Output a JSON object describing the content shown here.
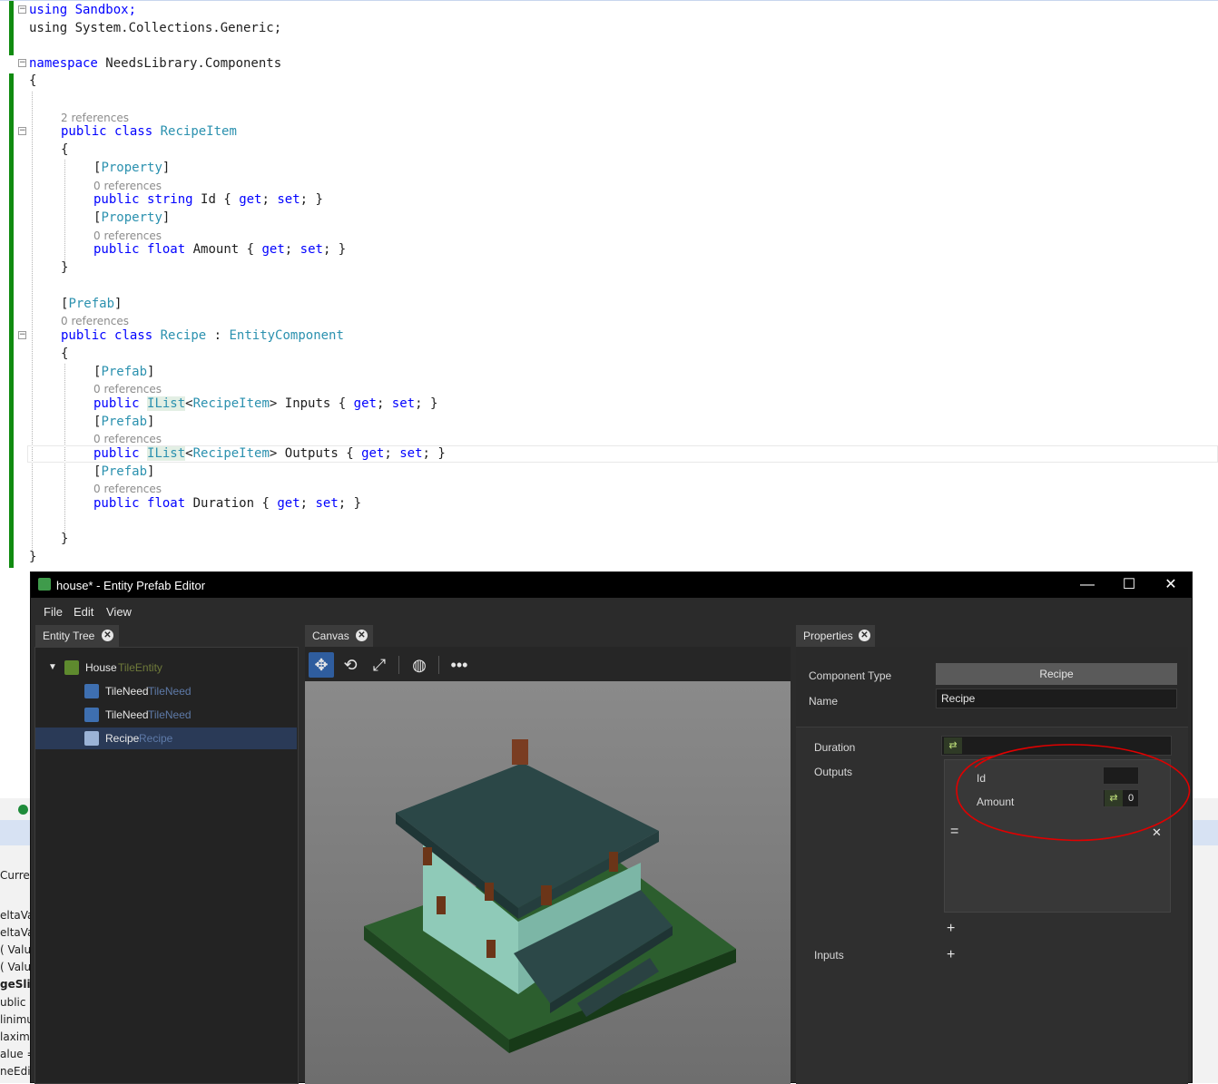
{
  "code": {
    "using1": "using Sandbox;",
    "using2": "using System.Collections.Generic;",
    "ns_kw": "namespace",
    "ns_name": " NeedsLibrary.Components",
    "open_brace": "{",
    "close_brace": "}",
    "lens_2refs": "2 references",
    "lens_0refs": "0 references",
    "kw_public": "public",
    "kw_class": "class",
    "kw_string": "string",
    "kw_float": "float",
    "kw_get": "get",
    "kw_set": "set",
    "class_recipeitem": "RecipeItem",
    "class_recipe": "Recipe",
    "base_class": "EntityComponent",
    "attr_property": "Property",
    "attr_prefab": "Prefab",
    "type_ilist": "IList",
    "prop_id": "Id",
    "prop_amount": "Amount",
    "prop_inputs": "Inputs",
    "prop_outputs": "Outputs",
    "prop_duration": "Duration"
  },
  "background_strip": [
    "Curren",
    "eltaVal",
    "eltaVal",
    "( Value",
    "( Value",
    "geSlid",
    "ublic",
    "linimu",
    "laximu",
    "alue =",
    "neEdit"
  ],
  "editor": {
    "title": "house* - Entity Prefab Editor",
    "window_buttons": {
      "minimize": "—",
      "maximize": "☐",
      "close": "✕"
    },
    "menu": [
      "File",
      "Edit",
      "View"
    ],
    "tabs": {
      "entity_tree": "Entity Tree",
      "canvas": "Canvas",
      "properties": "Properties"
    },
    "tree": [
      {
        "label": "House",
        "type": "TileEntity"
      },
      {
        "label": "TileNeed",
        "type": "TileNeed"
      },
      {
        "label": "TileNeed",
        "type": "TileNeed"
      },
      {
        "label": "Recipe",
        "type": "Recipe"
      }
    ],
    "canvas_tools": [
      "move-icon",
      "rotate-icon",
      "scale-icon",
      "globe-icon",
      "more-icon"
    ],
    "properties": {
      "component_type_label": "Component Type",
      "component_type_value": "Recipe",
      "name_label": "Name",
      "name_value": "Recipe",
      "duration_label": "Duration",
      "outputs_label": "Outputs",
      "id_label": "Id",
      "amount_label": "Amount",
      "amount_value": "0",
      "inputs_label": "Inputs",
      "add_symbol": "+",
      "remove_symbol": "✕",
      "drag_symbol": "="
    },
    "colors": {
      "accent": "#2f5d9e",
      "selection": "#2a3a57",
      "annotation": "#e00000"
    }
  }
}
